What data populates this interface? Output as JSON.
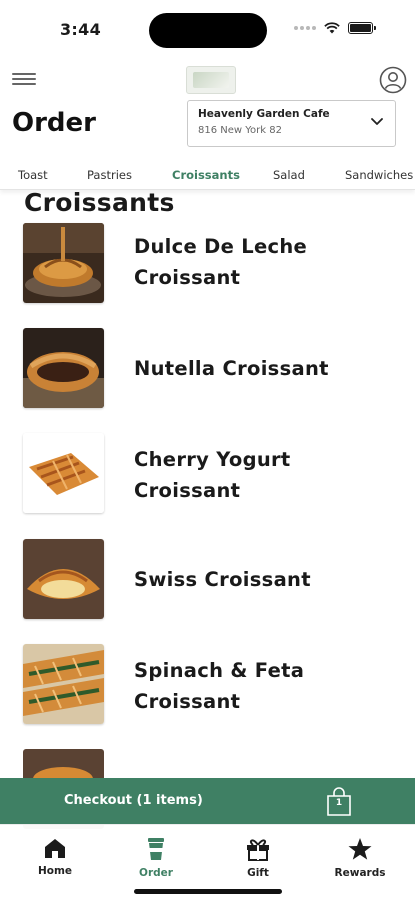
{
  "status_bar": {
    "time": "3:44"
  },
  "header": {
    "page_title": "Order",
    "store_name": "Heavenly Garden Cafe",
    "store_address": "816 New York 82"
  },
  "tabs": [
    {
      "label": "Toast",
      "active": false
    },
    {
      "label": "Pastries",
      "active": false
    },
    {
      "label": "Croissants",
      "active": true
    },
    {
      "label": "Salad",
      "active": false
    },
    {
      "label": "Sandwiches",
      "active": false
    }
  ],
  "section": {
    "title": "Croissants"
  },
  "products": [
    {
      "name": "Dulce De Leche Croissant",
      "line1": "Dulce De Leche",
      "line2": "Croissant",
      "image": "dulce-de-leche-croissant-photo"
    },
    {
      "name": "Nutella Croissant",
      "line1": "Nutella Croissant",
      "line2": "",
      "image": "nutella-croissant-photo"
    },
    {
      "name": "Cherry Yogurt Croissant",
      "line1": "Cherry Yogurt",
      "line2": "Croissant",
      "image": "cherry-yogurt-croissant-photo"
    },
    {
      "name": "Swiss Croissant",
      "line1": "Swiss Croissant",
      "line2": "",
      "image": "swiss-croissant-photo"
    },
    {
      "name": "Spinach & Feta Croissant",
      "line1": "Spinach & Feta",
      "line2": "Croissant",
      "image": "spinach-feta-croissant-photo"
    }
  ],
  "checkout": {
    "label": "Checkout (1 items)",
    "count": "1"
  },
  "bottom_nav": [
    {
      "label": "Home",
      "icon": "home-icon",
      "active": false
    },
    {
      "label": "Order",
      "icon": "cup-icon",
      "active": true
    },
    {
      "label": "Gift",
      "icon": "gift-icon",
      "active": false
    },
    {
      "label": "Rewards",
      "icon": "star-icon",
      "active": false
    }
  ],
  "colors": {
    "accent": "#3f8064",
    "text": "#1a1a1a"
  }
}
